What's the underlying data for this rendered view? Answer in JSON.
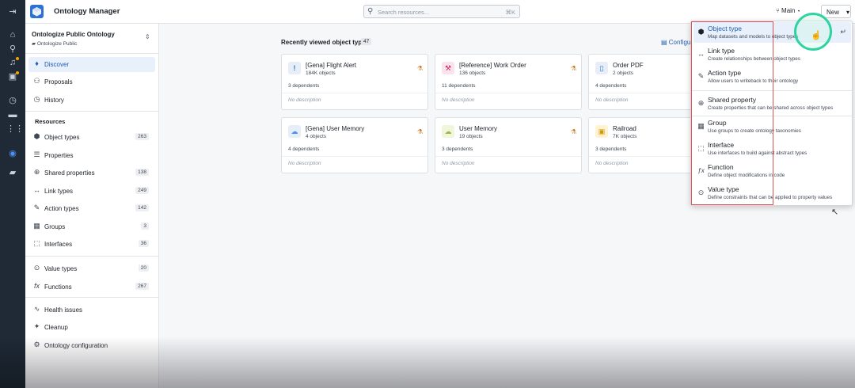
{
  "header": {
    "app_title": "Ontology Manager",
    "search_placeholder": "Search resources...",
    "search_shortcut": "⌘K",
    "branch": "Main",
    "new_button": "New"
  },
  "rail": {
    "icons": [
      "collapse-icon",
      "home-icon",
      "search-icon",
      "notifications-icon",
      "apps-icon",
      "history-icon",
      "files-icon",
      "grid-icon",
      "ontology-icon",
      "folder-icon"
    ]
  },
  "sidebar": {
    "ontology_name": "Ontologize Public Ontology",
    "ontology_sub": "Ontologize Public",
    "top_items": [
      {
        "label": "Discover",
        "icon": "compass-icon"
      },
      {
        "label": "Proposals",
        "icon": "proposals-icon"
      },
      {
        "label": "History",
        "icon": "history-icon"
      }
    ],
    "resources_title": "Resources",
    "resources": [
      {
        "label": "Object types",
        "count": "263"
      },
      {
        "label": "Properties",
        "count": ""
      },
      {
        "label": "Shared properties",
        "count": "138"
      },
      {
        "label": "Link types",
        "count": "249"
      },
      {
        "label": "Action types",
        "count": "142"
      },
      {
        "label": "Groups",
        "count": "3"
      },
      {
        "label": "Interfaces",
        "count": "36"
      }
    ],
    "resources2": [
      {
        "label": "Value types",
        "count": "20"
      },
      {
        "label": "Functions",
        "count": "267"
      }
    ],
    "bottom_items": [
      {
        "label": "Health issues"
      },
      {
        "label": "Cleanup"
      },
      {
        "label": "Ontology configuration"
      }
    ]
  },
  "main": {
    "section_title": "Recently viewed object types",
    "section_count": "47",
    "configure_label": "Configu",
    "cards": [
      {
        "name": "[Gena] Flight Alert",
        "objects": "184K objects",
        "dependents": "3 dependents",
        "description": "No description",
        "icon": "!",
        "icon_color": "#e8eef8",
        "icon_fg": "#2d72d2"
      },
      {
        "name": "[Reference] Work Order",
        "objects": "136 objects",
        "dependents": "11 dependents",
        "description": "No description",
        "icon": "⚒",
        "icon_color": "#fbe3ee",
        "icon_fg": "#c22762"
      },
      {
        "name": "Order PDF",
        "objects": "2 objects",
        "dependents": "4 dependents",
        "description": "No description",
        "icon": "▯",
        "icon_color": "#e8eef8",
        "icon_fg": "#2d72d2"
      },
      {
        "name": "[Gena] User Memory",
        "objects": "4 objects",
        "dependents": "4 dependents",
        "description": "No description",
        "icon": "☁",
        "icon_color": "#e5eef9",
        "icon_fg": "#4c90f0"
      },
      {
        "name": "User Memory",
        "objects": "19 objects",
        "dependents": "3 dependents",
        "description": "No description",
        "icon": "☁",
        "icon_color": "#f0f6dc",
        "icon_fg": "#a7b346"
      },
      {
        "name": "Railroad",
        "objects": "7K objects",
        "dependents": "3 dependents",
        "description": "No description",
        "icon": "▣",
        "icon_color": "#fdf3d0",
        "icon_fg": "#d1980b"
      }
    ]
  },
  "menu": {
    "items": [
      {
        "title": "Object type",
        "desc": "Map datasets and models to object types",
        "icon": "cube-icon",
        "glyph": "⬢"
      },
      {
        "title": "Link type",
        "desc": "Create relationships between object types",
        "icon": "link-icon",
        "glyph": "↔"
      },
      {
        "title": "Action type",
        "desc": "Allow users to writeback to their ontology",
        "icon": "action-icon",
        "glyph": "✎"
      },
      {
        "title": "Shared property",
        "desc": "Create properties that can be shared across object types",
        "icon": "globe-icon",
        "glyph": "⊕"
      },
      {
        "title": "Group",
        "desc": "Use groups to create ontology taxonomies",
        "icon": "group-icon",
        "glyph": "▦"
      },
      {
        "title": "Interface",
        "desc": "Use interfaces to build against abstract types",
        "icon": "interface-icon",
        "glyph": "⬚"
      },
      {
        "title": "Function",
        "desc": "Define object modifications in code",
        "icon": "function-icon",
        "glyph": "ƒx"
      },
      {
        "title": "Value type",
        "desc": "Define constraints that can be applied to property values",
        "icon": "value-icon",
        "glyph": "⊙"
      }
    ]
  }
}
